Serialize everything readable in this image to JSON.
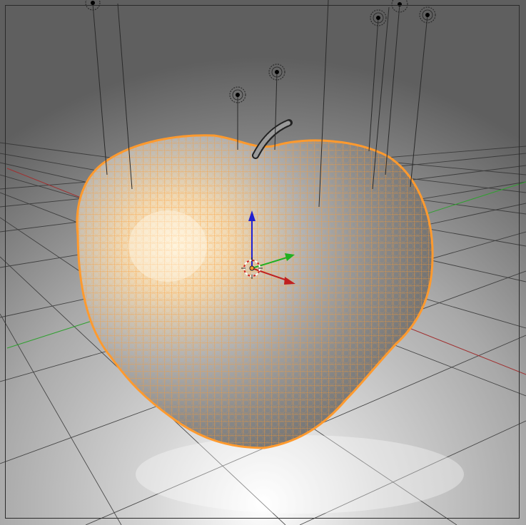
{
  "viewport": {
    "type": "3d-viewport",
    "object": "apple-mesh",
    "shading": "solid-with-wireframe",
    "selection_color": "#ff9a2e",
    "grid_color": "#3a3a3a",
    "axis_colors": {
      "x": "#c02020",
      "y": "#20c020",
      "z": "#2020d0"
    },
    "background_top": "#5c5c5c",
    "background_bottom": "#e8e8e8",
    "manipulator_visible": true,
    "lamp_count": 9
  }
}
